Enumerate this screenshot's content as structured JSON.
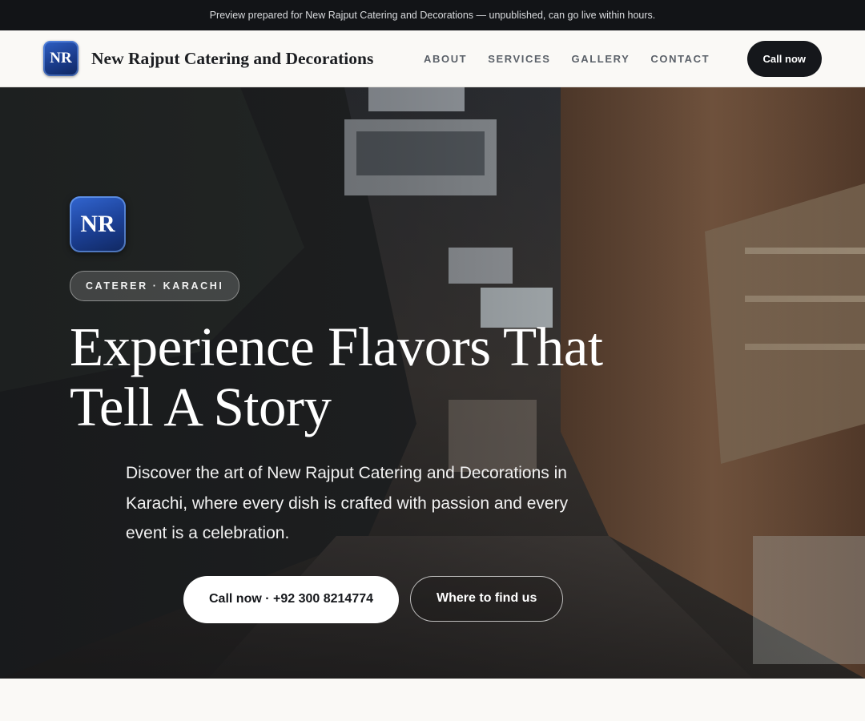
{
  "preview_bar": {
    "text": "Preview prepared for New Rajput Catering and Decorations — unpublished, can go live within hours."
  },
  "nav": {
    "logo_initials": "NR",
    "brand_name": "New Rajput Catering and Decorations",
    "links": [
      "ABOUT",
      "SERVICES",
      "GALLERY",
      "CONTACT"
    ],
    "cta_label": "Call now"
  },
  "hero": {
    "logo_initials": "NR",
    "eyebrow": "CATERER · KARACHI",
    "title_line1": "Experience Flavors That",
    "title_line2": "Tell A Story",
    "description": "Discover the art of New Rajput Catering and Decorations in Karachi, where every dish is crafted with passion and every event is a celebration.",
    "primary_cta": "Call now · +92 300 8214774",
    "secondary_cta": "Where to find us"
  },
  "colors": {
    "brand_blue": "#1a3c8c",
    "dark": "#15171b",
    "page_bg": "#faf9f6"
  }
}
